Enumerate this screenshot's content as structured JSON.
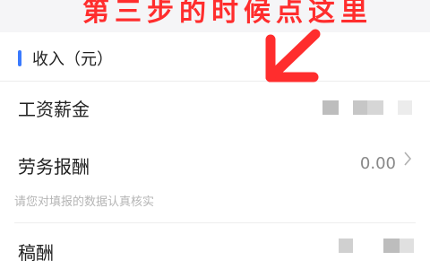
{
  "banner": {
    "text": "第三步的时候点这里"
  },
  "section": {
    "title": "收入（元）"
  },
  "rows": [
    {
      "label": "工资薪金",
      "value": ""
    },
    {
      "label": "劳务报酬",
      "value": "0.00"
    },
    {
      "label": "稿酬",
      "value": ""
    }
  ],
  "hint": "请您对填报的数据认真核实",
  "colors": {
    "accent": "#3a7afe",
    "annotation": "#ff2d2d"
  },
  "icons": {
    "row_chevron": "chevron-right-icon",
    "annotation_arrow": "arrow-down-right-icon"
  }
}
